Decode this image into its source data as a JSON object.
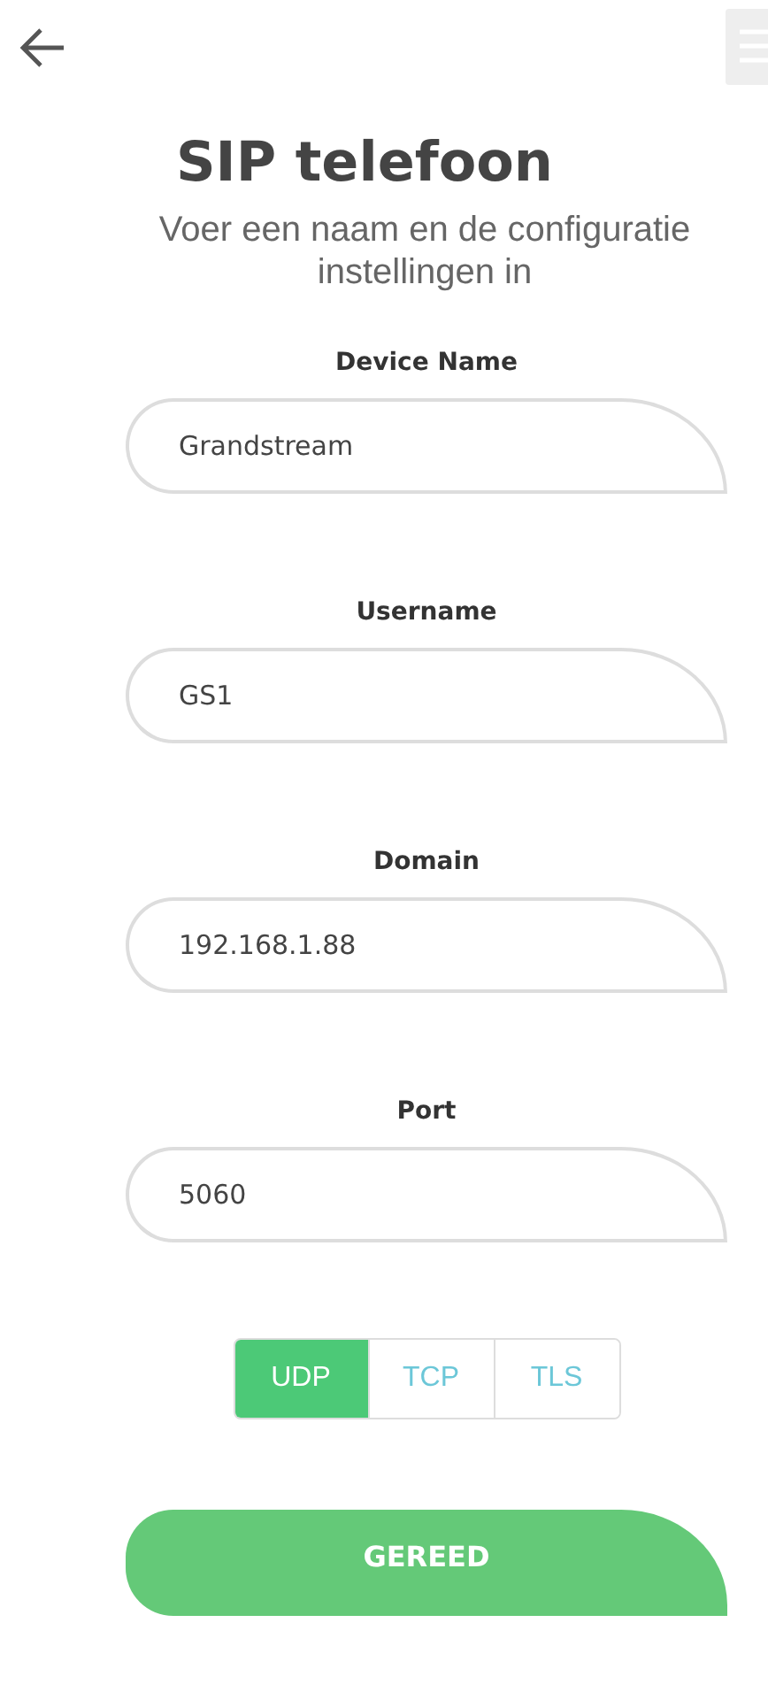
{
  "header": {
    "title": "SIP telefoon",
    "subtitle": "Voer een naam en de configuratie instellingen in"
  },
  "fields": [
    {
      "label": "Device Name",
      "value": "Grandstream"
    },
    {
      "label": "Username",
      "value": "GS1"
    },
    {
      "label": "Domain",
      "value": "192.168.1.88"
    },
    {
      "label": "Port",
      "value": "5060"
    }
  ],
  "transport": [
    {
      "label": "UDP",
      "selected": true
    },
    {
      "label": "TCP",
      "selected": false
    },
    {
      "label": "TLS",
      "selected": false
    }
  ],
  "submit": "GEREED"
}
